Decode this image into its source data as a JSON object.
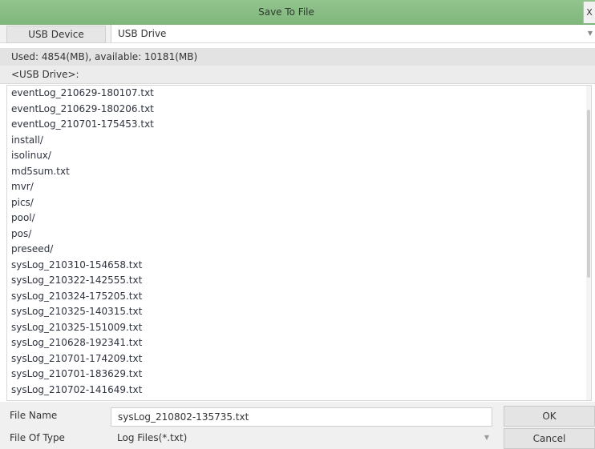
{
  "dialog": {
    "title": "Save To File",
    "close_label": "X"
  },
  "device": {
    "label": "USB Device",
    "selected": "USB Drive"
  },
  "storage_info": "Used: 4854(MB), available: 10181(MB)",
  "current_path": "<USB Drive>:",
  "files": [
    "eventLog_210629-180107.txt",
    "eventLog_210629-180206.txt",
    "eventLog_210701-175453.txt",
    "install/",
    "isolinux/",
    "md5sum.txt",
    "mvr/",
    "pics/",
    "pool/",
    "pos/",
    "preseed/",
    "sysLog_210310-154658.txt",
    "sysLog_210322-142555.txt",
    "sysLog_210324-175205.txt",
    "sysLog_210325-140315.txt",
    "sysLog_210325-151009.txt",
    "sysLog_210628-192341.txt",
    "sysLog_210701-174209.txt",
    "sysLog_210701-183629.txt",
    "sysLog_210702-141649.txt"
  ],
  "file_name": {
    "label": "File Name",
    "value": "sysLog_210802-135735.txt"
  },
  "file_type": {
    "label": "File Of Type",
    "value": "Log Files(*.txt)"
  },
  "buttons": {
    "ok": "OK",
    "cancel": "Cancel"
  }
}
